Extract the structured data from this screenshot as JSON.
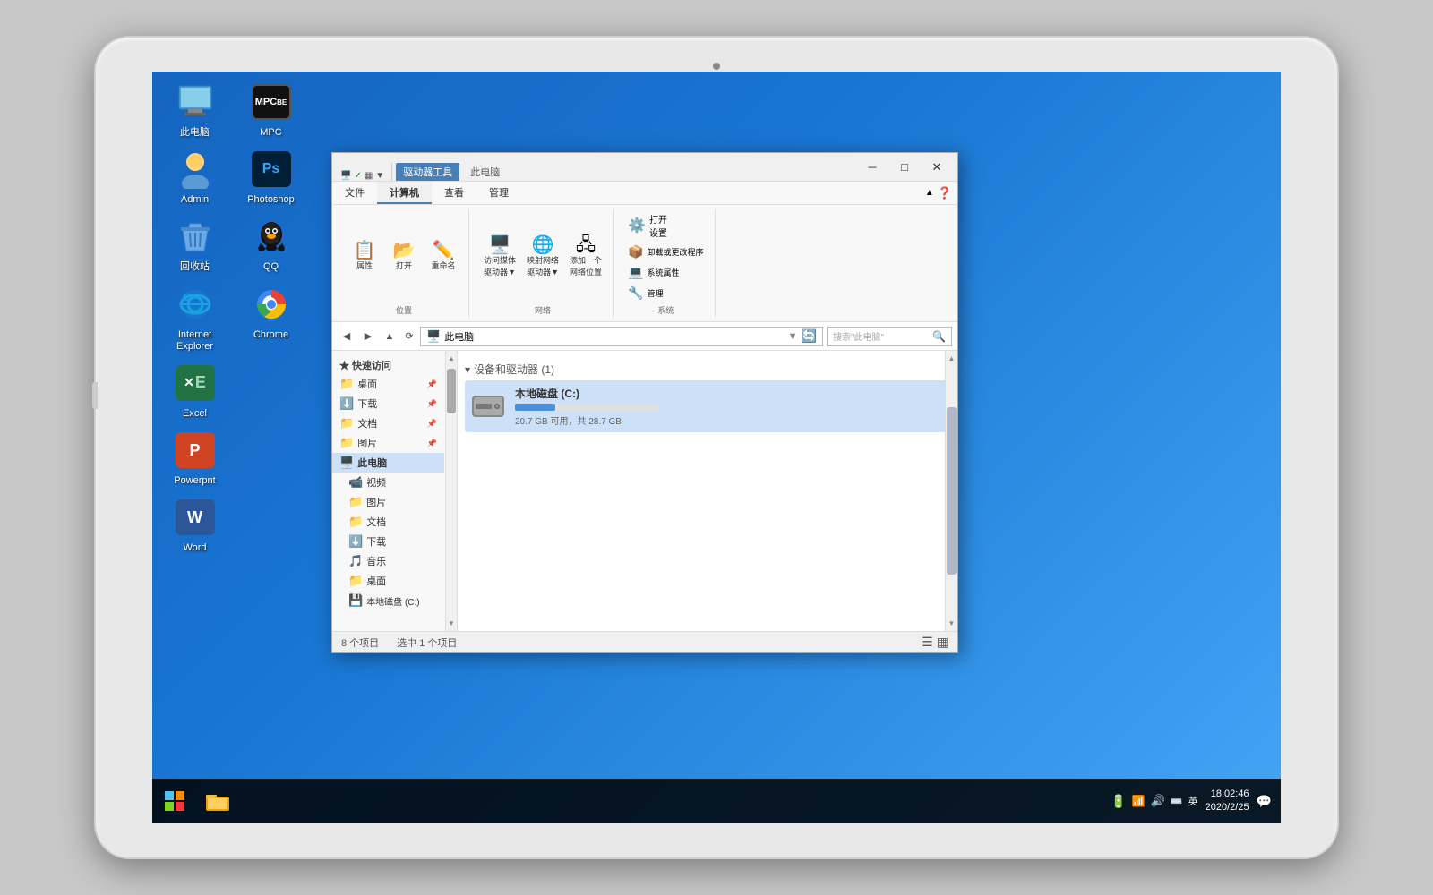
{
  "tablet": {
    "frame_color": "#e8e8e8"
  },
  "desktop": {
    "icons": [
      {
        "id": "this-pc",
        "label": "此电脑",
        "icon_type": "pc",
        "row": 0,
        "col": 0
      },
      {
        "id": "mpc",
        "label": "MPC",
        "icon_type": "mpc",
        "row": 0,
        "col": 1
      },
      {
        "id": "admin",
        "label": "Admin",
        "icon_type": "admin",
        "row": 1,
        "col": 0
      },
      {
        "id": "photoshop",
        "label": "Photoshop",
        "icon_type": "ps",
        "row": 1,
        "col": 1
      },
      {
        "id": "recycle",
        "label": "回收站",
        "icon_type": "recycle",
        "row": 2,
        "col": 0
      },
      {
        "id": "qq",
        "label": "QQ",
        "icon_type": "qq",
        "row": 2,
        "col": 1
      },
      {
        "id": "ie",
        "label": "Internet Explorer",
        "icon_type": "ie",
        "row": 3,
        "col": 0
      },
      {
        "id": "chrome",
        "label": "Chrome",
        "icon_type": "chrome",
        "row": 3,
        "col": 1
      },
      {
        "id": "excel",
        "label": "Excel",
        "icon_type": "excel",
        "row": 4,
        "col": 0
      },
      {
        "id": "powerpoint",
        "label": "Powerpnt",
        "icon_type": "ppt",
        "row": 5,
        "col": 0
      },
      {
        "id": "word",
        "label": "Word",
        "icon_type": "word",
        "row": 6,
        "col": 0
      }
    ]
  },
  "taskbar": {
    "start_tooltip": "开始",
    "clock_time": "18:02:46",
    "clock_date": "2020/2/25",
    "lang": "英",
    "notification_tooltip": "通知"
  },
  "file_explorer": {
    "title": "此电脑",
    "ribbon_tool_tab": "驱动器工具",
    "tabs": [
      "文件",
      "计算机",
      "查看",
      "管理"
    ],
    "active_tab": "计算机",
    "ribbon_groups": [
      {
        "label": "位置",
        "items": [
          {
            "label": "属性",
            "icon": "📋"
          },
          {
            "label": "打开",
            "icon": "📂"
          },
          {
            "label": "重命名",
            "icon": "✏️"
          }
        ]
      },
      {
        "label": "网络",
        "items": [
          {
            "label": "访问媒体\n驱动器▼",
            "icon": "🖥️"
          },
          {
            "label": "映射网络\n驱动器▼",
            "icon": "🌐"
          },
          {
            "label": "添加一个\n网络位置",
            "icon": "🖧"
          }
        ]
      },
      {
        "label": "系统",
        "items": [
          {
            "label": "打开\n设置",
            "icon": "⚙️"
          },
          {
            "label": "卸载或更改程序",
            "icon": "📦"
          },
          {
            "label": "系统属性",
            "icon": "💻"
          },
          {
            "label": "管理",
            "icon": "🔧"
          }
        ]
      }
    ],
    "address": "此电脑",
    "search_placeholder": "搜索\"此电脑\"",
    "sidebar": {
      "quick_access_label": "★ 快速访问",
      "items_quick": [
        {
          "label": "桌面",
          "pinned": true
        },
        {
          "label": "下载",
          "pinned": true
        },
        {
          "label": "文档",
          "pinned": true
        },
        {
          "label": "图片",
          "pinned": true
        }
      ],
      "this_pc_label": "此电脑",
      "items_pc": [
        {
          "label": "视频"
        },
        {
          "label": "图片"
        },
        {
          "label": "文档"
        },
        {
          "label": "下载"
        },
        {
          "label": "音乐"
        },
        {
          "label": "桌面"
        },
        {
          "label": "本地磁盘 (C:)"
        }
      ]
    },
    "content": {
      "section_label": "设备和驱动器 (1)",
      "drives": [
        {
          "name": "本地磁盘 (C:)",
          "free_gb": "20.7",
          "total_gb": "28.7",
          "fill_percent": 28,
          "label": "20.7 GB 可用，共 28.7 GB"
        }
      ]
    },
    "statusbar": {
      "total": "8 个项目",
      "selected": "选中 1 个项目"
    }
  }
}
